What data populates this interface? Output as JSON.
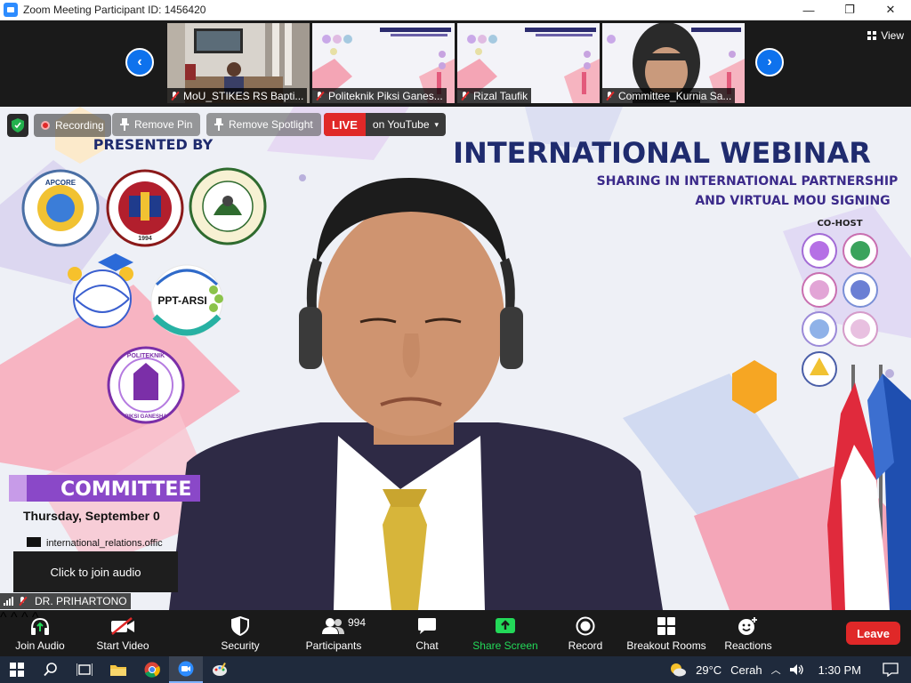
{
  "window": {
    "title": "Zoom Meeting Participant ID: 1456420",
    "minimize": "—",
    "maximize": "❐",
    "close": "✕"
  },
  "strip": {
    "prev": "‹",
    "next": "›",
    "view_label": "View",
    "thumbnails": [
      {
        "label": "MoU_STIKES RS Bapti..."
      },
      {
        "label": "Politeknik Piksi Ganes..."
      },
      {
        "label": "Rizal Taufik"
      },
      {
        "label": "Committee_Kurnia Sa..."
      }
    ]
  },
  "slide": {
    "presented_by": "PRESENTED BY",
    "title": "INTERNATIONAL WEBINAR",
    "subtitle_1": "SHARING IN INTERNATIONAL PARTNERSHIP",
    "subtitle_2": "AND VIRTUAL MOU SIGNING",
    "co_host": "CO-HOST",
    "ppt_arsi": "PPT-ARSI",
    "committee": "COMMITTEE",
    "date_line": "Thursday, September 0",
    "email_line": "international_relations.offic",
    "logo_texts": {
      "apcore": "APCORE",
      "year": "1994",
      "quezon": "QUEZON CITY UNIVERSITY",
      "manila": "UNIVERSIDAD DE MANILA",
      "politeknik": "POLITEKNIK",
      "piksi": "PIKSI GANESHA"
    }
  },
  "overlays": {
    "recording": "Recording",
    "remove_pin": "Remove Pin",
    "remove_spotlight": "Remove Spotlight",
    "live": "LIVE",
    "on_youtube": "on YouTube",
    "join_audio_tooltip": "Click to join audio",
    "speaker_name": "DR. PRIHARTONO"
  },
  "toolbar": {
    "join_audio": "Join Audio",
    "start_video": "Start Video",
    "security": "Security",
    "participants": "Participants",
    "participants_count": "994",
    "chat": "Chat",
    "share_screen": "Share Screen",
    "record": "Record",
    "breakout_rooms": "Breakout Rooms",
    "reactions": "Reactions",
    "leave": "Leave",
    "caret": "^"
  },
  "taskbar": {
    "temperature": "29°C",
    "weather": "Cerah",
    "time": "1:30 PM"
  },
  "colors": {
    "zoom_blue": "#0e72ed",
    "toolbar_bg": "#1a1a1a",
    "leave_red": "#e02828",
    "share_green": "#23d959",
    "taskbar_bg": "#1f2a3c"
  }
}
